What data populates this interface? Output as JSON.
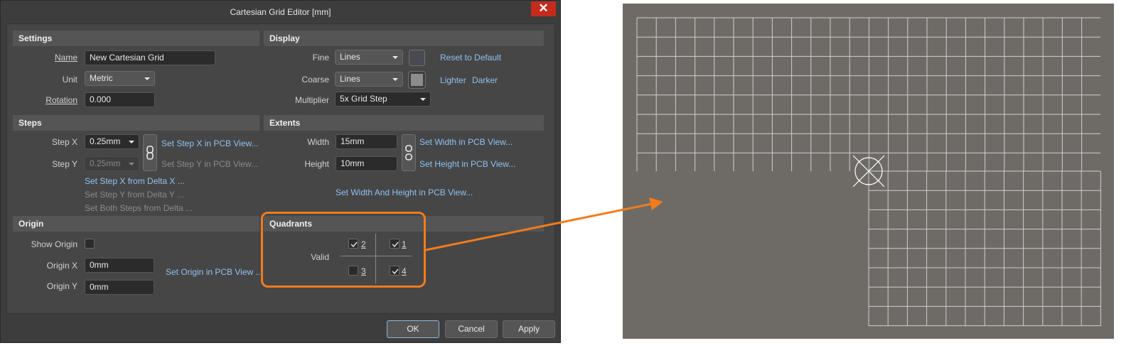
{
  "window": {
    "title": "Cartesian Grid Editor [mm]",
    "close_glyph": "✕"
  },
  "settings": {
    "header": "Settings",
    "name_label": "Name",
    "name_value": "New Cartesian Grid",
    "unit_label": "Unit",
    "unit_value": "Metric",
    "rotation_label": "Rotation",
    "rotation_value": "0.000"
  },
  "display": {
    "header": "Display",
    "fine_label": "Fine",
    "fine_value": "Lines",
    "fine_color": "#4a4a52",
    "coarse_label": "Coarse",
    "coarse_value": "Lines",
    "coarse_color": "#8c8c8c",
    "multiplier_label": "Multiplier",
    "multiplier_value": "5x Grid Step",
    "reset_link": "Reset to Default",
    "lighter_link": "Lighter",
    "darker_link": "Darker"
  },
  "steps": {
    "header": "Steps",
    "step_x_label": "Step X",
    "step_x_value": "0.25mm",
    "step_y_label": "Step Y",
    "step_y_value": "0.25mm",
    "set_step_x_pcb": "Set Step X in PCB View...",
    "set_step_y_pcb": "Set Step Y in PCB View...",
    "set_step_x_delta": "Set Step X from Delta X ...",
    "set_step_y_delta": "Set Step Y from Delta Y ...",
    "set_both_delta": "Set Both Steps from Delta ..."
  },
  "extents": {
    "header": "Extents",
    "width_label": "Width",
    "width_value": "15mm",
    "height_label": "Height",
    "height_value": "10mm",
    "set_width_pcb": "Set Width in PCB View...",
    "set_height_pcb": "Set Height in PCB View...",
    "set_both_pcb": "Set Width And Height in PCB View..."
  },
  "origin": {
    "header": "Origin",
    "show_origin_label": "Show Origin",
    "show_origin_checked": false,
    "origin_x_label": "Origin X",
    "origin_x_value": "0mm",
    "origin_y_label": "Origin Y",
    "origin_y_value": "0mm",
    "set_origin_pcb": "Set Origin in PCB View ..."
  },
  "quadrants": {
    "header": "Quadrants",
    "valid_label": "Valid",
    "q1": {
      "label": "1",
      "checked": true
    },
    "q2": {
      "label": "2",
      "checked": true
    },
    "q3": {
      "label": "3",
      "checked": false
    },
    "q4": {
      "label": "4",
      "checked": true
    }
  },
  "buttons": {
    "ok": "OK",
    "cancel": "Cancel",
    "apply": "Apply"
  },
  "colors": {
    "highlight": "#f07c1e",
    "canvas_bg": "#6e6b66",
    "grid_line": "#cfcfcf"
  },
  "icons": {
    "link": "chain-link-icon",
    "origin_marker": "origin-crosshair-icon"
  }
}
